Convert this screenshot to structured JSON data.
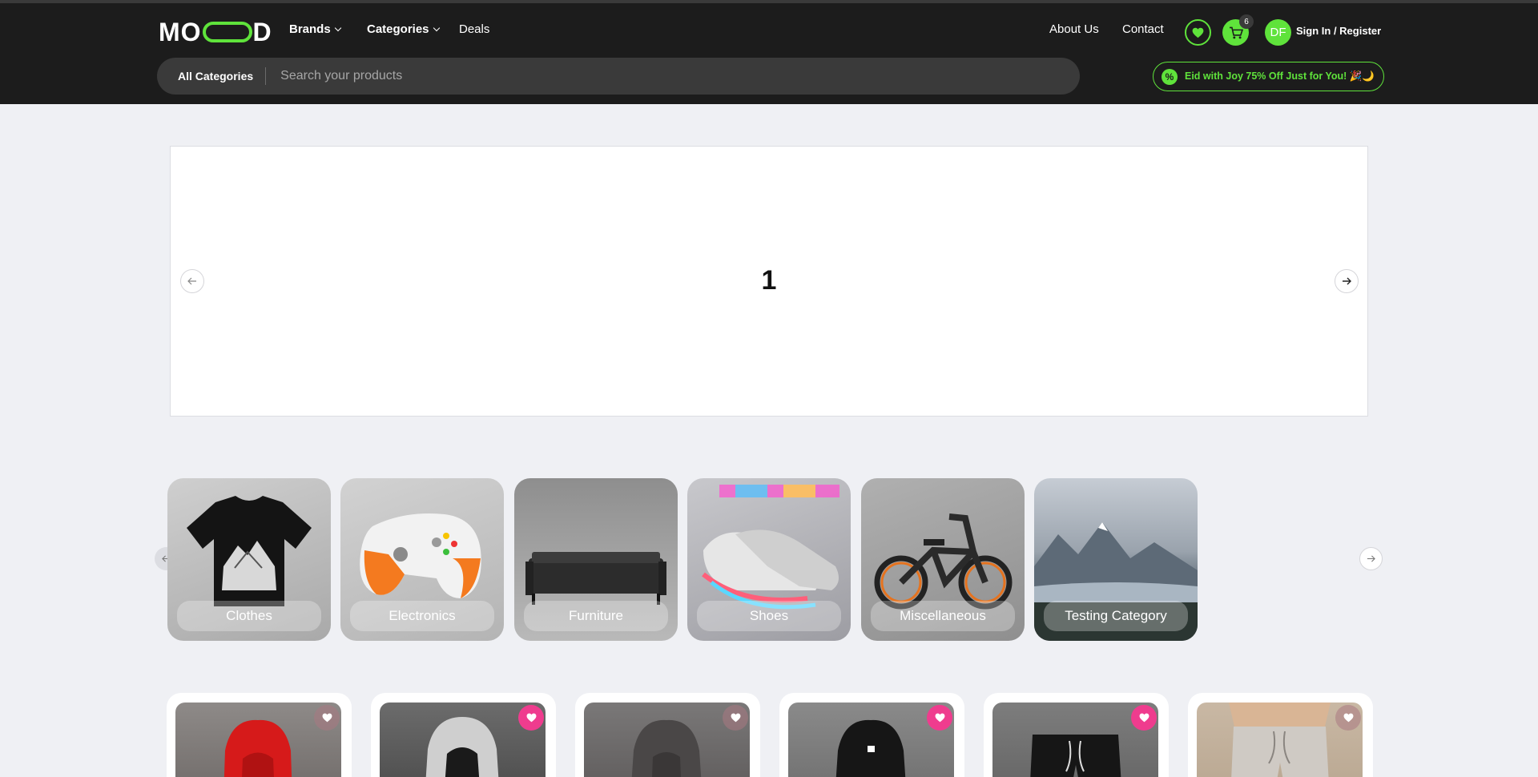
{
  "header": {
    "logo_left": "MO",
    "logo_right": "D",
    "nav": [
      {
        "label": "Brands"
      },
      {
        "label": "Categories"
      },
      {
        "label": "Deals"
      }
    ],
    "about": "About Us",
    "contact": "Contact",
    "cart_count": "6",
    "avatar_initials": "DF",
    "signin": "Sign In / Register",
    "accent_color": "#5fe33b"
  },
  "search": {
    "category": "All Categories",
    "placeholder": "Search your products"
  },
  "promo": {
    "icon": "%",
    "text": "Eid with Joy 75% Off Just for You! 🎉🌙"
  },
  "hero": {
    "slide_number": "1"
  },
  "categories": [
    {
      "label": "Clothes",
      "icon": "tshirt-image"
    },
    {
      "label": "Electronics",
      "icon": "gamepad-image"
    },
    {
      "label": "Furniture",
      "icon": "sofa-image"
    },
    {
      "label": "Shoes",
      "icon": "sneakers-image"
    },
    {
      "label": "Miscellaneous",
      "icon": "bicycle-image"
    },
    {
      "label": "Testing Category",
      "icon": "mountain-lake-image"
    }
  ],
  "products": [
    {
      "image": "red-hoodie",
      "favorited": false
    },
    {
      "image": "grey-black-hoodie",
      "favorited": true
    },
    {
      "image": "dark-grey-hoodie",
      "favorited": false
    },
    {
      "image": "black-hoodie",
      "favorited": true
    },
    {
      "image": "black-shorts",
      "favorited": true
    },
    {
      "image": "grey-sweatpants",
      "favorited": true
    }
  ]
}
